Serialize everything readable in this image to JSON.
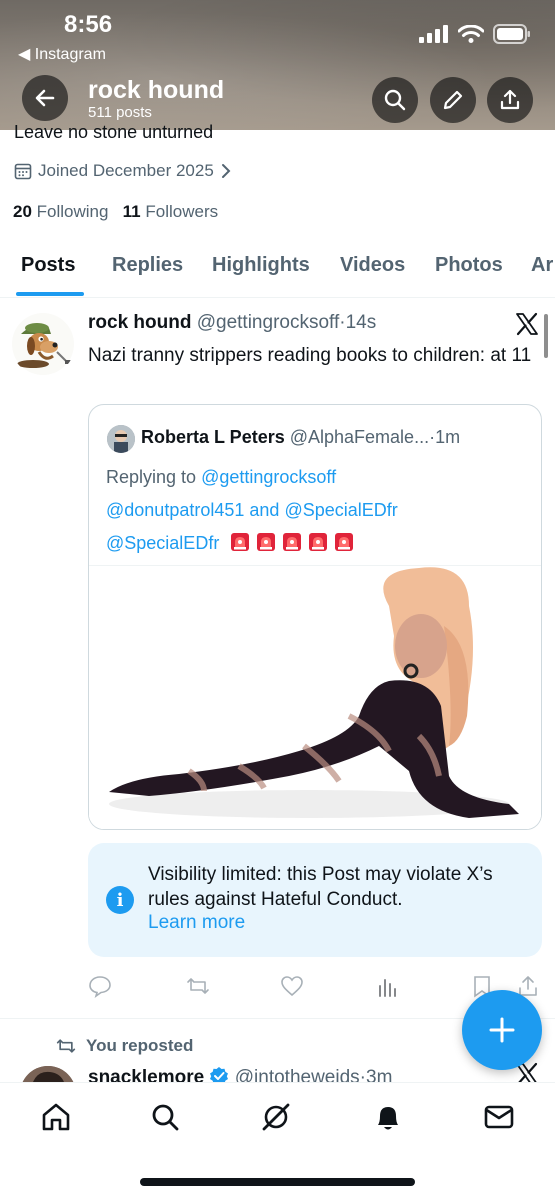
{
  "status_bar": {
    "time": "8:56",
    "back_app": "◀ Instagram"
  },
  "header": {
    "name": "rock hound",
    "posts": "511 posts",
    "icons": [
      "back-arrow-icon",
      "search-icon",
      "pencil-icon",
      "share-icon"
    ]
  },
  "profile": {
    "bio": "Leave no stone unturned",
    "joined": "Joined December 2025",
    "following_count": "20",
    "following_label": "Following",
    "followers_count": "11",
    "followers_label": "Followers"
  },
  "tabs": [
    "Posts",
    "Replies",
    "Highlights",
    "Videos",
    "Photos",
    "Ar"
  ],
  "post": {
    "name": "rock hound",
    "handle": "@gettingrocksoff",
    "sep": "·",
    "time": "14s",
    "text": "Nazi tranny strippers reading books to children: at 11",
    "quote": {
      "name": "Roberta L Peters",
      "handle": "@AlphaFemale...",
      "sep": "·",
      "time": "1m",
      "replying_prefix": "Replying to",
      "mention_1": "@gettingrocksoff",
      "mention_2": "@donutpatrol451",
      "and_text": "and",
      "mention_3": "@SpecialEDfr",
      "mention_4": "@SpecialEDfr",
      "siren_count": 5
    },
    "notice": {
      "text": "Visibility limited: this Post may violate X’s rules against Hateful Conduct.",
      "link": "Learn more",
      "icon": "info-icon"
    }
  },
  "next_post": {
    "repost_label": "You reposted",
    "name": "snacklemore",
    "handle": "@intotheweids",
    "sep": "·",
    "time": "3m"
  },
  "bottom_nav": [
    "home-icon",
    "search-icon",
    "grok-icon",
    "notifications-icon",
    "messages-icon"
  ],
  "colors": {
    "accent": "#1d9bf0",
    "text": "#0f1419",
    "muted": "#536471",
    "notice_bg": "#e8f5fd"
  }
}
